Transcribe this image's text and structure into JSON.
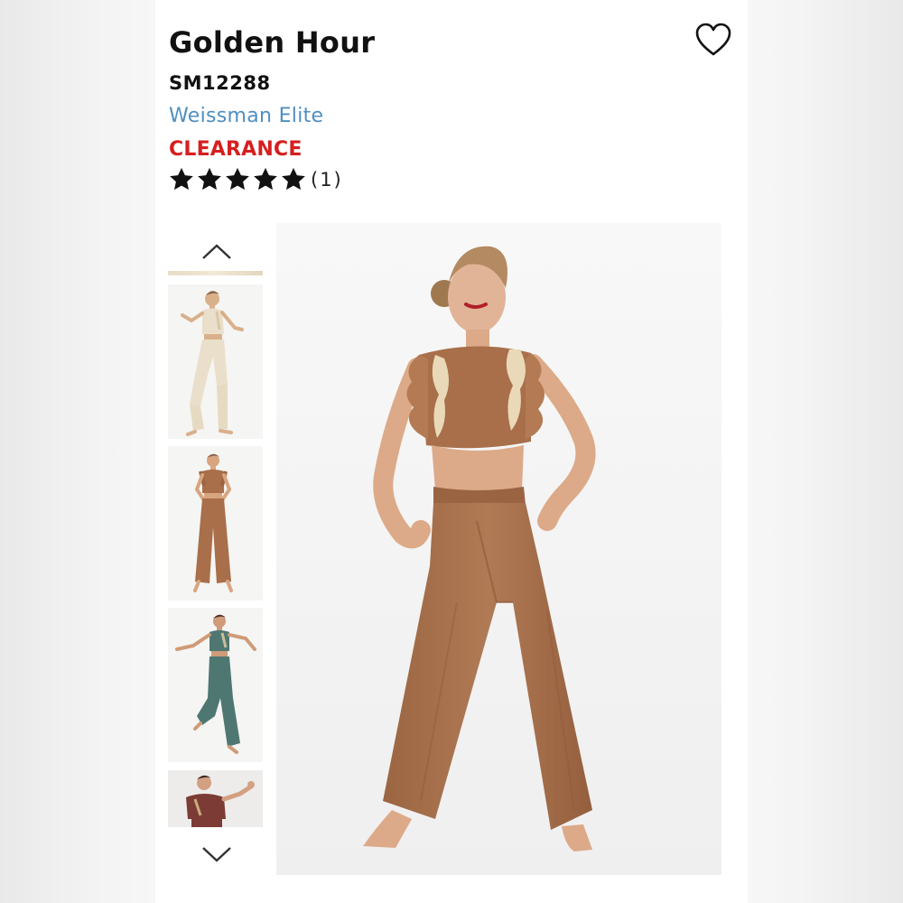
{
  "product": {
    "title": "Golden Hour",
    "sku": "SM12288",
    "brand": "Weissman Elite",
    "status_badge": "CLEARANCE",
    "rating": {
      "stars": 5,
      "max_stars": 5,
      "count_text": "(1)"
    }
  },
  "icons": {
    "wishlist": "heart-outline-icon",
    "gallery_up": "chevron-up-icon",
    "gallery_down": "chevron-down-icon",
    "star": "star-filled-icon"
  },
  "gallery": {
    "thumbnails": [
      {
        "name": "Ivory / cream variant"
      },
      {
        "name": "Tan / caramel variant"
      },
      {
        "name": "Teal variant"
      },
      {
        "name": "Burgundy variant"
      }
    ],
    "main_image": {
      "name": "Tan / caramel variant"
    }
  },
  "colors": {
    "brand_link": "#4f8fc0",
    "clearance": "#d61f1f",
    "text": "#111111",
    "costume_tan": "#a86f4a",
    "costume_ivory": "#eadfca",
    "costume_teal": "#4f7772",
    "costume_burgundy": "#7c3b35"
  }
}
